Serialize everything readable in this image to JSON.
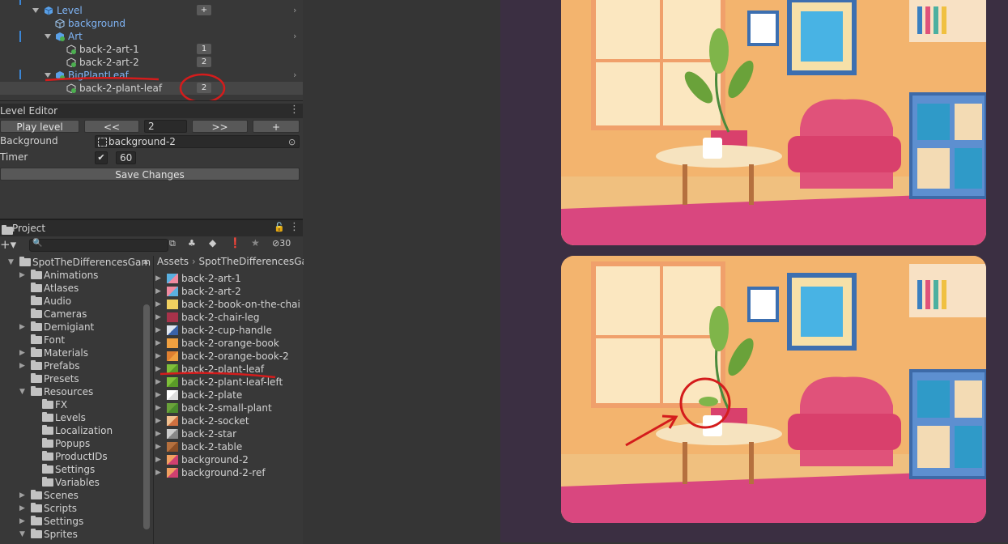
{
  "hierarchy": {
    "items": [
      {
        "label": "Level",
        "badge": "+"
      },
      {
        "label": "background"
      },
      {
        "label": "Art"
      },
      {
        "label": "back-2-art-1",
        "badge": "1"
      },
      {
        "label": "back-2-art-2",
        "badge": "2"
      },
      {
        "label": "BigPlantLeaf"
      },
      {
        "label": "back-2-plant-leaf",
        "badge": "2"
      }
    ]
  },
  "level_editor": {
    "title": "Level Editor",
    "play_label": "Play level",
    "prev_label": "<<",
    "level_value": "2",
    "next_label": ">>",
    "add_label": "+",
    "background_label": "Background",
    "background_value": "background-2",
    "timer_label": "Timer",
    "timer_value": "60",
    "save_label": "Save Changes"
  },
  "project": {
    "title": "Project",
    "hidden_count": "30",
    "breadcrumb": [
      "Assets",
      "SpotTheDifferencesGa"
    ],
    "tree": [
      {
        "label": "SpotTheDifferencesGam"
      },
      {
        "label": "Animations"
      },
      {
        "label": "Atlases"
      },
      {
        "label": "Audio"
      },
      {
        "label": "Cameras"
      },
      {
        "label": "Demigiant"
      },
      {
        "label": "Font"
      },
      {
        "label": "Materials"
      },
      {
        "label": "Prefabs"
      },
      {
        "label": "Presets"
      },
      {
        "label": "Resources"
      },
      {
        "label": "FX"
      },
      {
        "label": "Levels"
      },
      {
        "label": "Localization"
      },
      {
        "label": "Popups"
      },
      {
        "label": "ProductIDs"
      },
      {
        "label": "Settings"
      },
      {
        "label": "Variables"
      },
      {
        "label": "Scenes"
      },
      {
        "label": "Scripts"
      },
      {
        "label": "Settings"
      },
      {
        "label": "Sprites"
      }
    ],
    "assets": [
      {
        "label": "back-2-art-1"
      },
      {
        "label": "back-2-art-2"
      },
      {
        "label": "back-2-book-on-the-chai"
      },
      {
        "label": "back-2-chair-leg"
      },
      {
        "label": "back-2-cup-handle"
      },
      {
        "label": "back-2-orange-book"
      },
      {
        "label": "back-2-orange-book-2"
      },
      {
        "label": "back-2-plant-leaf"
      },
      {
        "label": "back-2-plant-leaf-left"
      },
      {
        "label": "back-2-plate"
      },
      {
        "label": "back-2-small-plant"
      },
      {
        "label": "back-2-socket"
      },
      {
        "label": "back-2-star"
      },
      {
        "label": "back-2-table"
      },
      {
        "label": "background-2"
      },
      {
        "label": "background-2-ref"
      }
    ]
  },
  "colors": {
    "annotation_red": "#d41c1c",
    "game_bg": "#3b2f42",
    "wall": "#f7a86d",
    "rug": "#d83b84",
    "chair": "#e0527a"
  }
}
